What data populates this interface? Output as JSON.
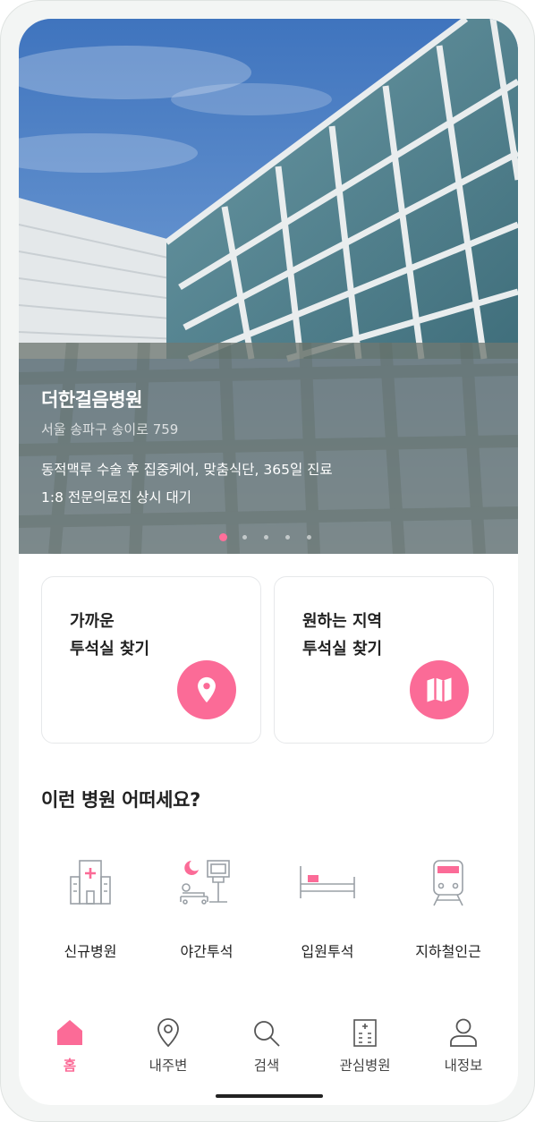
{
  "theme": {
    "accent": "#fb6b97",
    "icon_stroke": "#9aa0a6",
    "text": "#222222"
  },
  "carousel": {
    "hospital_name": "더한걸음병원",
    "address": "서울 송파구 송이로 759",
    "description_lines": [
      "동적맥루 수술 후 집중케어, 맞춤식단, 365일 진료",
      "1:8 전문의료진 상시 대기"
    ],
    "slide_count": 5,
    "active_slide": 1
  },
  "feature_cards": [
    {
      "lines": [
        "가까운",
        "투석실 찾기"
      ],
      "icon": "map-pin-icon"
    },
    {
      "lines": [
        "원하는 지역",
        "투석실 찾기"
      ],
      "icon": "folded-map-icon"
    }
  ],
  "recommend": {
    "title": "이런 병원 어떠세요?",
    "categories": [
      {
        "label": "신규병원",
        "icon": "hospital-building-icon"
      },
      {
        "label": "야간투석",
        "icon": "night-dialysis-icon"
      },
      {
        "label": "입원투석",
        "icon": "hospital-bed-icon"
      },
      {
        "label": "지하철인근",
        "icon": "subway-train-icon"
      }
    ]
  },
  "bottom_nav": {
    "active": "홈",
    "items": [
      {
        "label": "홈",
        "icon": "home-icon"
      },
      {
        "label": "내주변",
        "icon": "location-pin-icon"
      },
      {
        "label": "검색",
        "icon": "search-icon"
      },
      {
        "label": "관심병원",
        "icon": "hospital-list-icon"
      },
      {
        "label": "내정보",
        "icon": "user-icon"
      }
    ]
  }
}
